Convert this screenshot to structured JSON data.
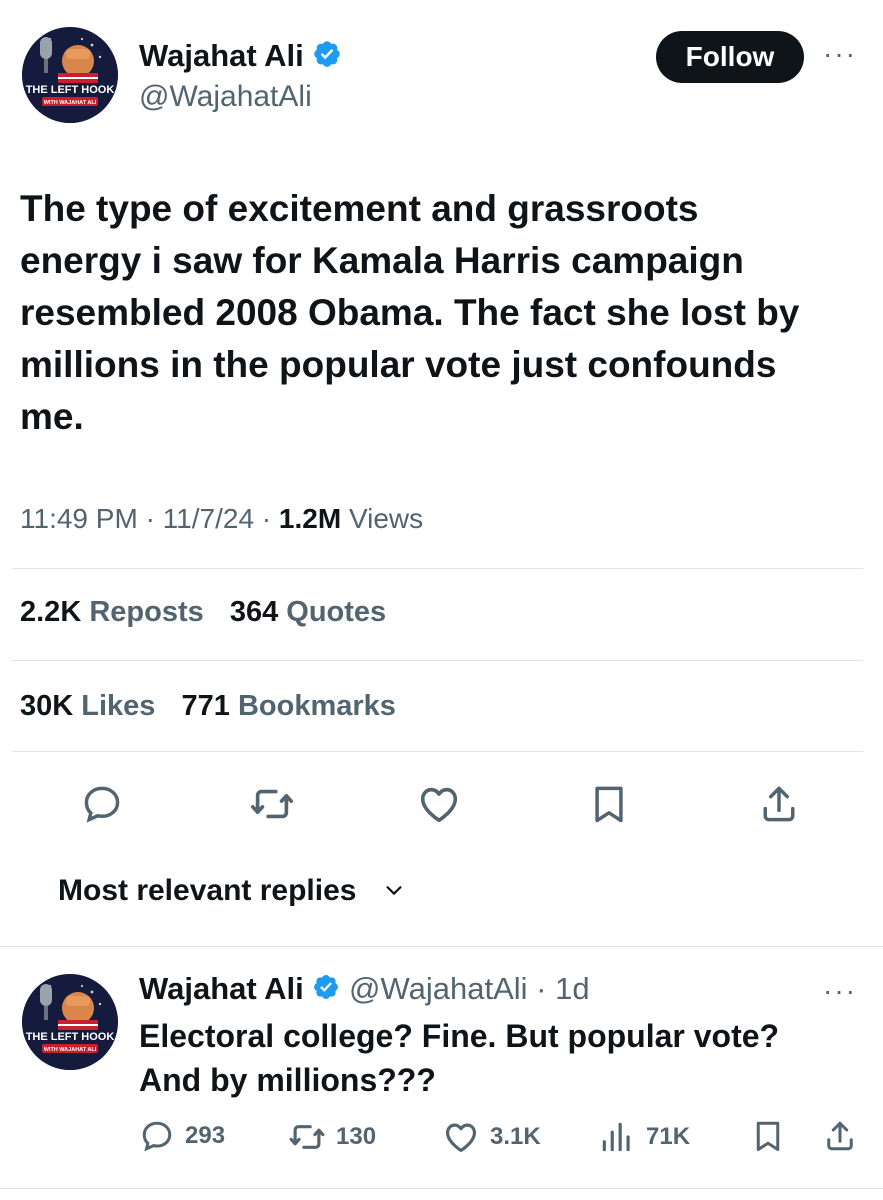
{
  "author": {
    "name": "Wajahat Ali",
    "handle": "@WajahatAli",
    "avatar_text": "THE LEFT HOOK",
    "avatar_subtext": "WITH WAJAHAT ALI"
  },
  "follow_label": "Follow",
  "more_label": "···",
  "tweet": {
    "lines": [
      "The type of excitement and grassroots",
      "energy i saw for Kamala Harris campaign",
      "resembled 2008 Obama. The fact she lost by",
      "millions in the popular vote just confounds",
      "me."
    ],
    "time": "11:49 PM",
    "date": "11/7/24",
    "views_count": "1.2M",
    "views_label": "Views",
    "separator": "·"
  },
  "stats": {
    "reposts_count": "2.2K",
    "reposts_label": "Reposts",
    "quotes_count": "364",
    "quotes_label": "Quotes",
    "likes_count": "30K",
    "likes_label": "Likes",
    "bookmarks_count": "771",
    "bookmarks_label": "Bookmarks"
  },
  "replies_header": "Most relevant replies",
  "reply": {
    "name": "Wajahat Ali",
    "handle": "@WajahatAli",
    "age": "· 1d",
    "line1": "Electoral college? Fine. But popular vote?",
    "line2": "And by millions???",
    "replies": "293",
    "reposts": "130",
    "likes": "3.1K",
    "views": "71K"
  },
  "colors": {
    "text": "#0f1419",
    "secondary": "#536471",
    "verified": "#1d9bf0",
    "divider": "#e1e4e8"
  }
}
